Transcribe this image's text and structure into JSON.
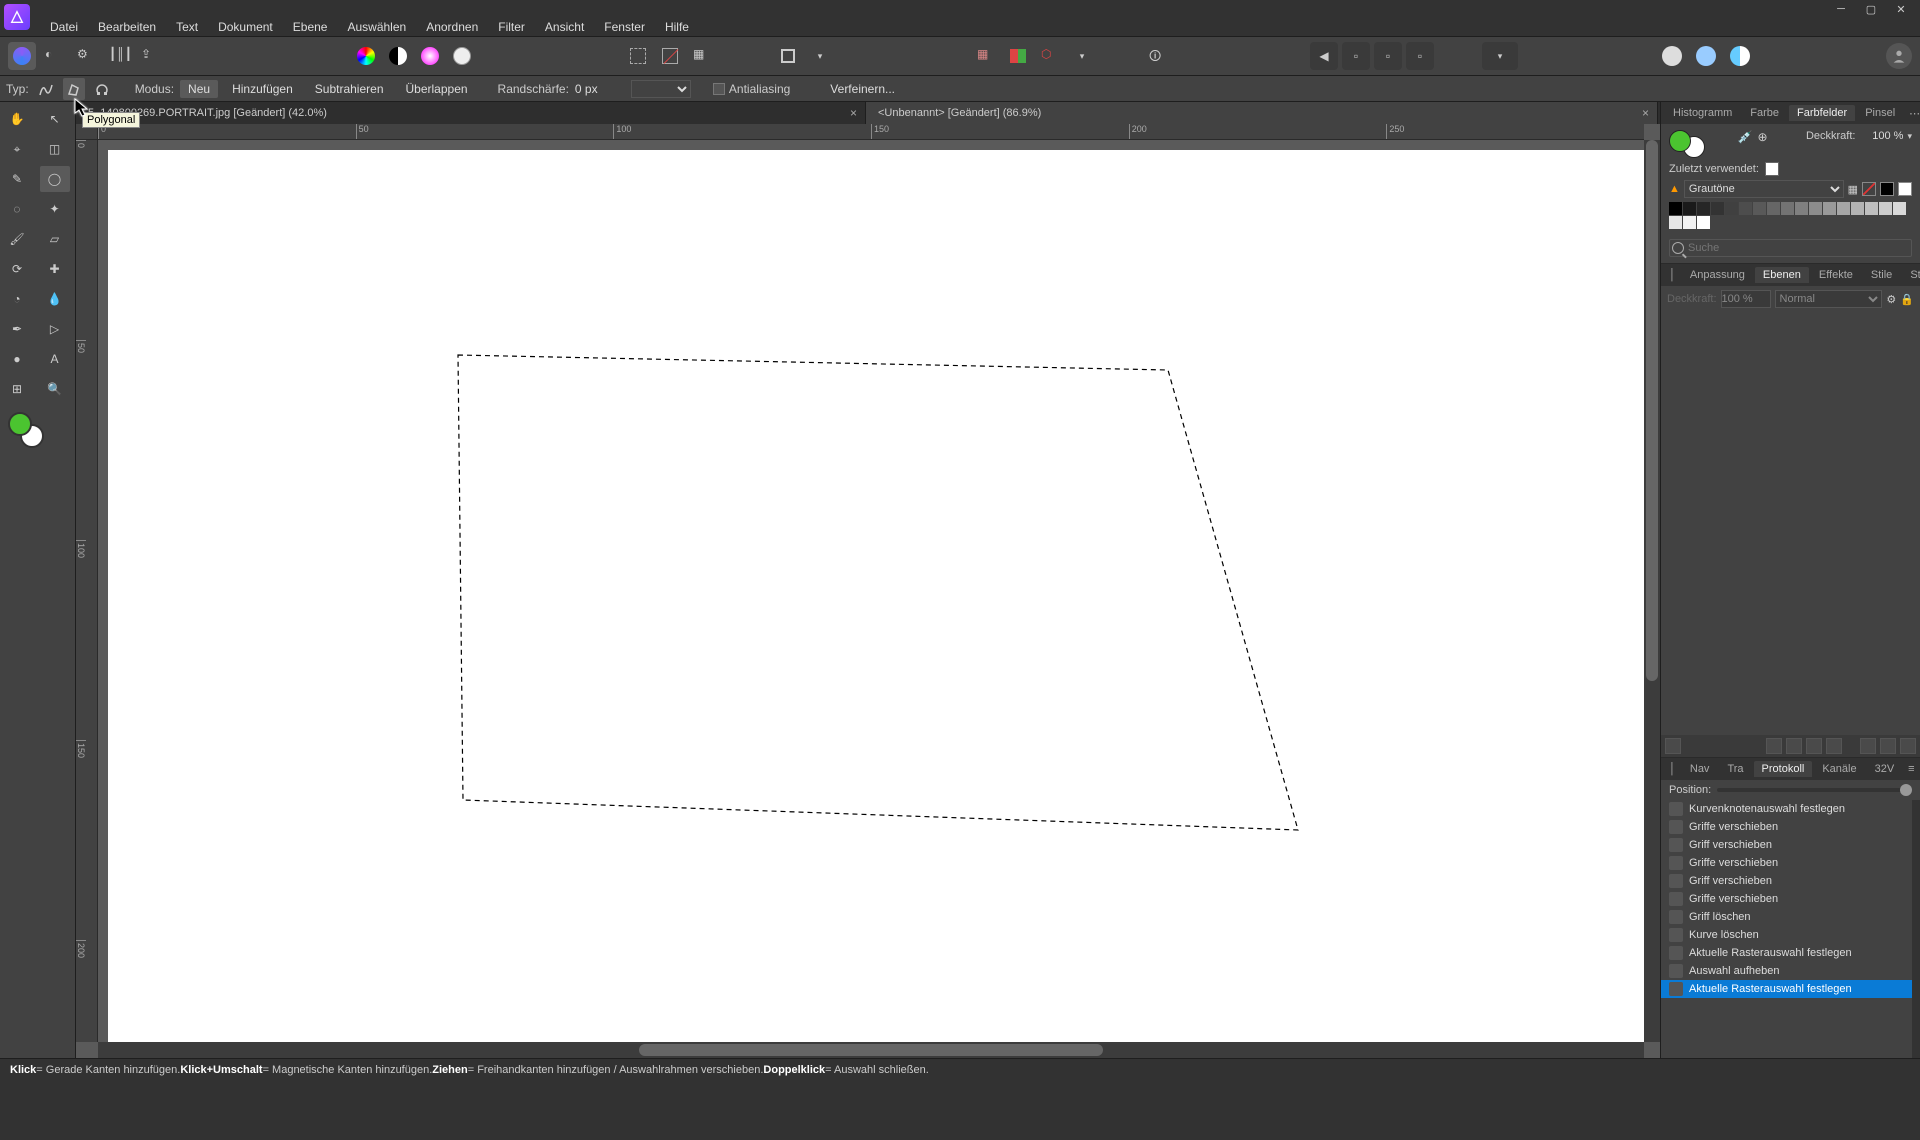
{
  "menu": [
    "Datei",
    "Bearbeiten",
    "Text",
    "Dokument",
    "Ebene",
    "Auswählen",
    "Anordnen",
    "Filter",
    "Ansicht",
    "Fenster",
    "Hilfe"
  ],
  "context": {
    "typ_label": "Typ:",
    "modus_label": "Modus:",
    "modes": [
      "Neu",
      "Hinzufügen",
      "Subtrahieren",
      "Überlappen"
    ],
    "feather_label": "Randschärfe:",
    "feather_value": "0 px",
    "antialias": "Antialiasing",
    "refine": "Verfeinern..."
  },
  "tooltip": "Polygonal",
  "tabs": [
    {
      "label": "5_140800269.PORTRAIT.jpg [Geändert] (42.0%)",
      "active": false
    },
    {
      "label": "<Unbenannt>  [Geändert] (86.9%)",
      "active": true
    }
  ],
  "ruler_h": [
    "0",
    "50",
    "100",
    "150",
    "200",
    "250"
  ],
  "ruler_v": [
    "0",
    "50",
    "100",
    "150",
    "200"
  ],
  "swatches": {
    "tabs": [
      "Histogramm",
      "Farbe",
      "Farbfelder",
      "Pinsel"
    ],
    "active_tab": 2,
    "opacity_label": "Deckkraft:",
    "opacity_value": "100 %",
    "recent_label": "Zuletzt verwendet:",
    "palette_label": "Grautöne",
    "search_placeholder": "Suche",
    "grays_top": [
      "#000000",
      "#1a1a1a",
      "#262626",
      "#333333",
      "#404040",
      "#4d4d4d",
      "#595959",
      "#666666",
      "#737373",
      "#808080",
      "#8c8c8c",
      "#999999",
      "#a6a6a6",
      "#b3b3b3",
      "#bfbfbf",
      "#cccccc"
    ],
    "grays_bot": [
      "#d9d9d9",
      "#e6e6e6",
      "#f2f2f2",
      "#ffffff"
    ]
  },
  "layers": {
    "tabs": [
      "Anpassung",
      "Ebenen",
      "Effekte",
      "Stile",
      "Stock"
    ],
    "active_tab": 1,
    "opacity": "100 %",
    "blend": "Normal"
  },
  "history": {
    "tabs": [
      "Nav",
      "Tra",
      "Protokoll",
      "Kanäle",
      "32V"
    ],
    "active_tab": 2,
    "position_label": "Position:",
    "items": [
      "Kurvenknotenauswahl festlegen",
      "Griffe verschieben",
      "Griff verschieben",
      "Griffe verschieben",
      "Griff verschieben",
      "Griffe verschieben",
      "Griff löschen",
      "Kurve löschen",
      "Aktuelle Rasterauswahl festlegen",
      "Auswahl aufheben",
      "Aktuelle Rasterauswahl festlegen"
    ],
    "selected": 10
  },
  "status": {
    "p1b": "Klick",
    "p1": " = Gerade Kanten hinzufügen. ",
    "p2b": "Klick+Umschalt",
    "p2": " = Magnetische Kanten hinzufügen. ",
    "p3b": "Ziehen",
    "p3": " = Freihandkanten hinzufügen / Auswahlrahmen verschieben. ",
    "p4b": "Doppelklick",
    "p4": " = Auswahl schließen."
  }
}
